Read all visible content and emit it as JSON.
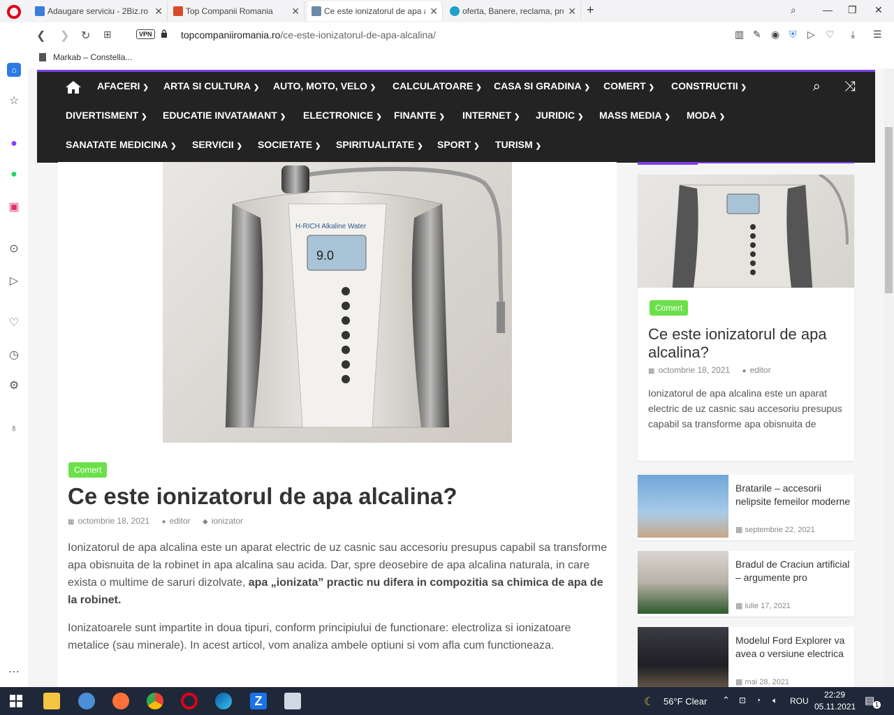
{
  "browser": {
    "tabs": [
      {
        "title": "Adaugare serviciu - 2Biz.ro",
        "color": "#3b7dd8"
      },
      {
        "title": "Top Companii Romania",
        "color": "#d84b2a"
      },
      {
        "title": "Ce este ionizatorul de apa alcalina?",
        "color": "#6b8aa8"
      },
      {
        "title": "oferta, Banere, reclama, pro",
        "color": "#1da1c9"
      }
    ],
    "url_host": "topcompaniiromania.ro",
    "url_path": "/ce-este-ionizatorul-de-apa-alcalina/",
    "vpn_label": "VPN",
    "bookmark": "Markab – Constella..."
  },
  "nav": {
    "row1": [
      "AFACERI",
      "ARTA SI CULTURA",
      "AUTO, MOTO, VELO",
      "CALCULATOARE",
      "CASA SI GRADINA",
      "COMERT",
      "CONSTRUCTII"
    ],
    "row2": [
      "DIVERTISMENT",
      "EDUCATIE INVATAMANT",
      "ELECTRONICE",
      "FINANTE",
      "INTERNET",
      "JURIDIC",
      "MASS MEDIA",
      "MODA"
    ],
    "row3": [
      "SANATATE MEDICINA",
      "SERVICII",
      "SOCIETATE",
      "SPIRITUALITATE",
      "SPORT",
      "TURISM"
    ]
  },
  "article": {
    "category": "Comert",
    "title": "Ce este ionizatorul de apa alcalina?",
    "date": "octombrie 18, 2021",
    "author": "editor",
    "tag": "ionizator",
    "p1_text": "Ionizatorul de apa alcalina este un aparat electric de uz casnic sau accesoriu presupus capabil sa transforme apa obisnuita de la robinet in apa alcalina sau acida. Dar, spre deosebire de apa alcalina naturala, in care exista o multime de saruri dizolvate, ",
    "p1_bold": "apa „ionizata” practic nu difera in compozitia sa chimica de apa de la robinet.",
    "p2": "Ionizatoarele sunt impartite in doua tipuri, conform principiului de functionare: electroliza si ionizatoare metalice (sau minerale). In acest articol, vom analiza ambele optiuni si vom afla cum functioneaza.",
    "device_brand": "H-RICH Alkaline Water",
    "device_ph": "9.0"
  },
  "sidebar": {
    "featured": {
      "category": "Comert",
      "title": "Ce este ionizatorul de apa alcalina?",
      "date": "octombrie 18, 2021",
      "author": "editor",
      "excerpt": "Ionizatorul de apa alcalina este un aparat electric de uz casnic sau accesoriu presupus capabil sa transforme apa obisnuita de"
    },
    "posts": [
      {
        "title": "Bratarile – accesorii nelipsite femeilor moderne",
        "date": "septembrie 22, 2021"
      },
      {
        "title": "Bradul de Craciun artificial – argumente pro",
        "date": "iulie 17, 2021"
      },
      {
        "title": "Modelul Ford Explorer va avea o versiune electrica",
        "date": "mai 28, 2021"
      }
    ]
  },
  "taskbar": {
    "weather": "56°F  Clear",
    "lang": "ROU",
    "time": "22:29",
    "date": "05.11.2021",
    "notifications": "1"
  }
}
